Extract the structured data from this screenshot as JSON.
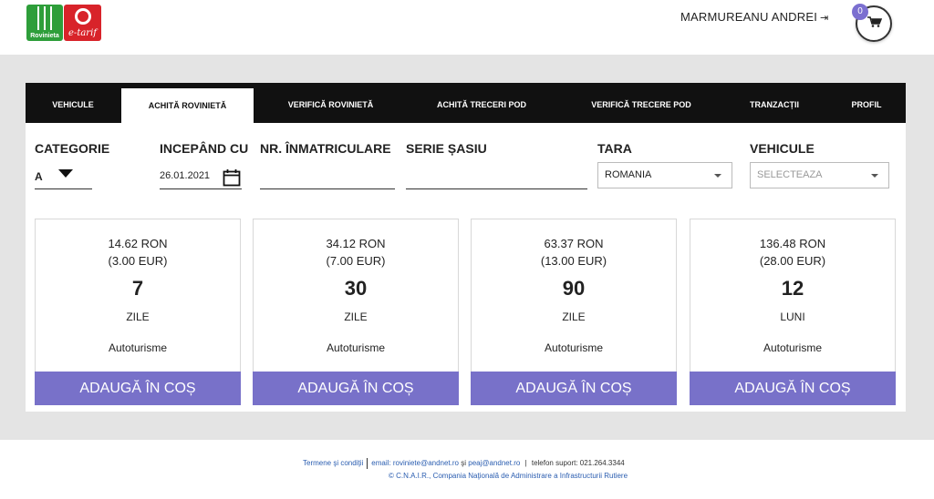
{
  "header": {
    "logo_rovinieta_text": "Rovinieta",
    "logo_etarif_text": "e-tarif",
    "user_name": "MARMUREANU ANDREI",
    "cart_count": "0"
  },
  "tabs": [
    {
      "label": "VEHICULE",
      "active": false
    },
    {
      "label": "ACHITĂ ROVINIETĂ",
      "active": true
    },
    {
      "label": "VERIFICĂ ROVINIETĂ",
      "active": false
    },
    {
      "label": "ACHITĂ TRECERI POD",
      "active": false
    },
    {
      "label": "VERIFICĂ TRECERE POD",
      "active": false
    },
    {
      "label": "TRANZACȚII",
      "active": false
    },
    {
      "label": "PROFIL",
      "active": false
    }
  ],
  "form": {
    "categorie_label": "CATEGORIE",
    "categorie_value": "A",
    "incepand_label": "INCEPÂND CU",
    "incepand_value": "26.01.2021",
    "nr_label": "NR. ÎNMATRICULARE",
    "nr_value": "",
    "serie_label": "SERIE ȘASIU",
    "serie_value": "",
    "tara_label": "TARA",
    "tara_value": "ROMANIA",
    "vehicule_label": "VEHICULE",
    "vehicule_placeholder": "SELECTEAZA"
  },
  "cards": [
    {
      "ron": "14.62 RON",
      "eur": "(3.00 EUR)",
      "duration": "7",
      "unit": "ZILE",
      "vehicle": "Autoturisme",
      "button": "ADAUGĂ ÎN COȘ"
    },
    {
      "ron": "34.12 RON",
      "eur": "(7.00 EUR)",
      "duration": "30",
      "unit": "ZILE",
      "vehicle": "Autoturisme",
      "button": "ADAUGĂ ÎN COȘ"
    },
    {
      "ron": "63.37 RON",
      "eur": "(13.00 EUR)",
      "duration": "90",
      "unit": "ZILE",
      "vehicle": "Autoturisme",
      "button": "ADAUGĂ ÎN COȘ"
    },
    {
      "ron": "136.48 RON",
      "eur": "(28.00 EUR)",
      "duration": "12",
      "unit": "LUNI",
      "vehicle": "Autoturisme",
      "button": "ADAUGĂ ÎN COȘ"
    }
  ],
  "footer": {
    "terms": "Termene şi condiţii",
    "email_label": "email:",
    "email1": "roviniete@andnet.ro",
    "and": "şi",
    "email2": "peaj@andnet.ro",
    "phone": "telefon suport: 021.264.3344",
    "copyright_symbol": "© C.N.A.I.R.,",
    "copyright_link": "Compania Naţională de Administrare a Infrastructurii Rutiere"
  },
  "colors": {
    "accent": "#7871c9",
    "tabbar": "#111111",
    "background": "#e4e4e4",
    "rovinieta_green": "#2e9e3a",
    "etarif_red": "#d8232a"
  },
  "icons": [
    "logout-icon",
    "shopping-cart-icon",
    "calendar-icon",
    "dropdown-caret-icon"
  ]
}
